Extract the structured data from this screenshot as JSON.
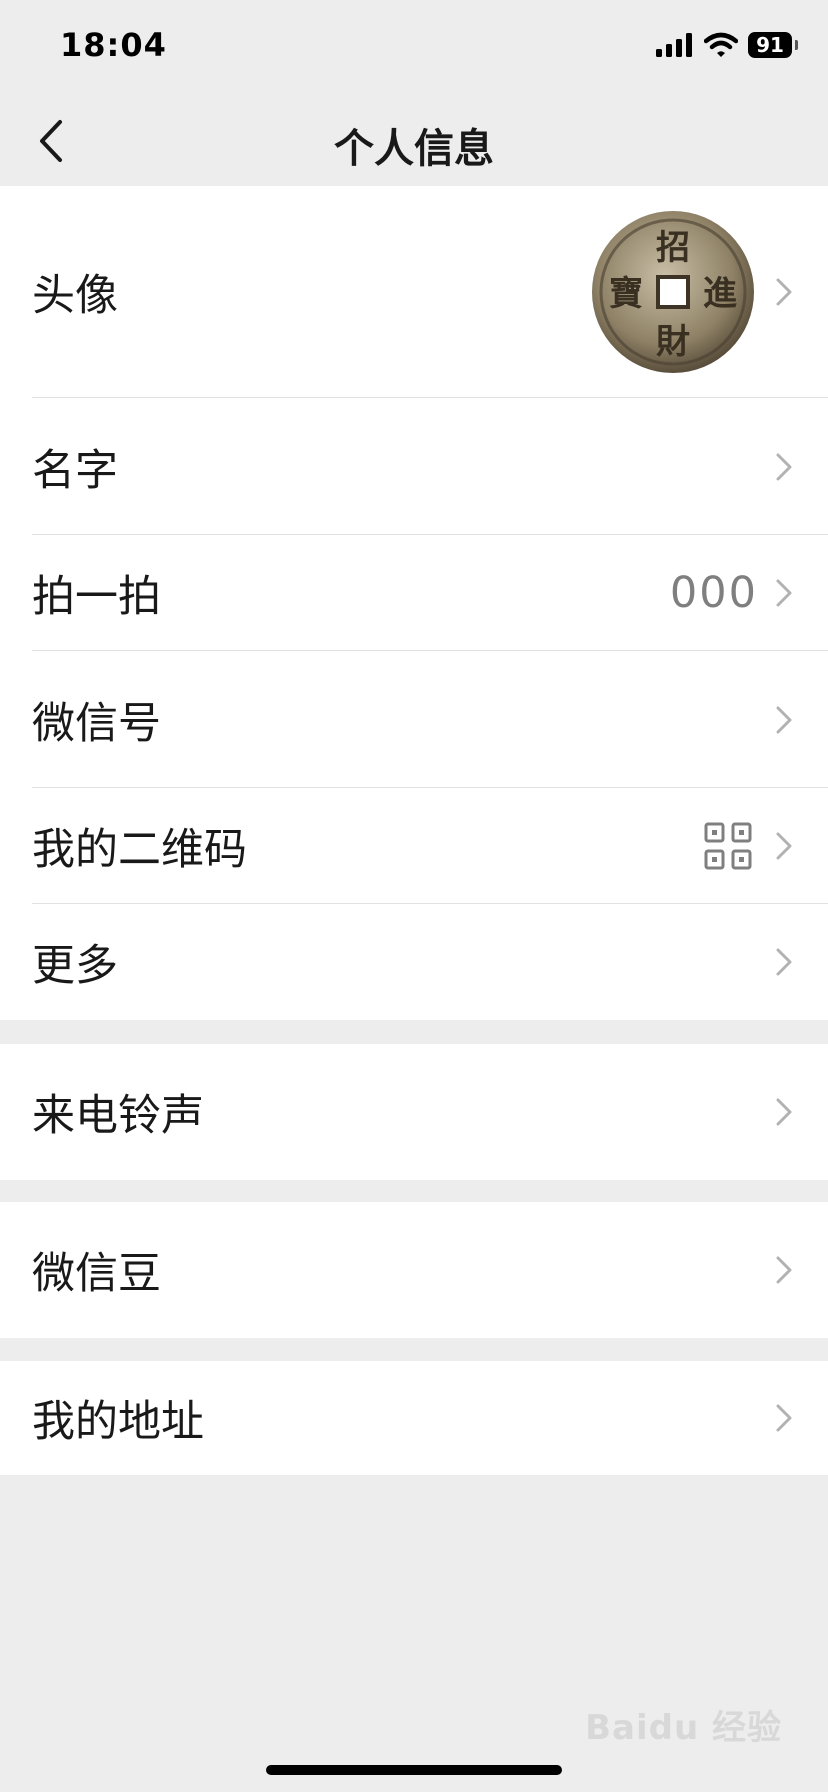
{
  "status_bar": {
    "time": "18:04",
    "battery": "91"
  },
  "nav": {
    "title": "个人信息"
  },
  "profile_group": [
    {
      "label": "头像",
      "value": ""
    },
    {
      "label": "名字",
      "value": ""
    },
    {
      "label": "拍一拍",
      "value": "000"
    },
    {
      "label": "微信号",
      "value": ""
    },
    {
      "label": "我的二维码",
      "value": ""
    },
    {
      "label": "更多",
      "value": ""
    }
  ],
  "ringtone": {
    "label": "来电铃声"
  },
  "beans": {
    "label": "微信豆"
  },
  "address": {
    "label": "我的地址"
  },
  "avatar_text": [
    "招",
    "進",
    "財",
    "寶"
  ],
  "watermark": "Baidu 经验",
  "colors": {
    "background": "#ededed",
    "row": "#ffffff",
    "text": "#191919",
    "secondary": "#7f7f7f"
  }
}
